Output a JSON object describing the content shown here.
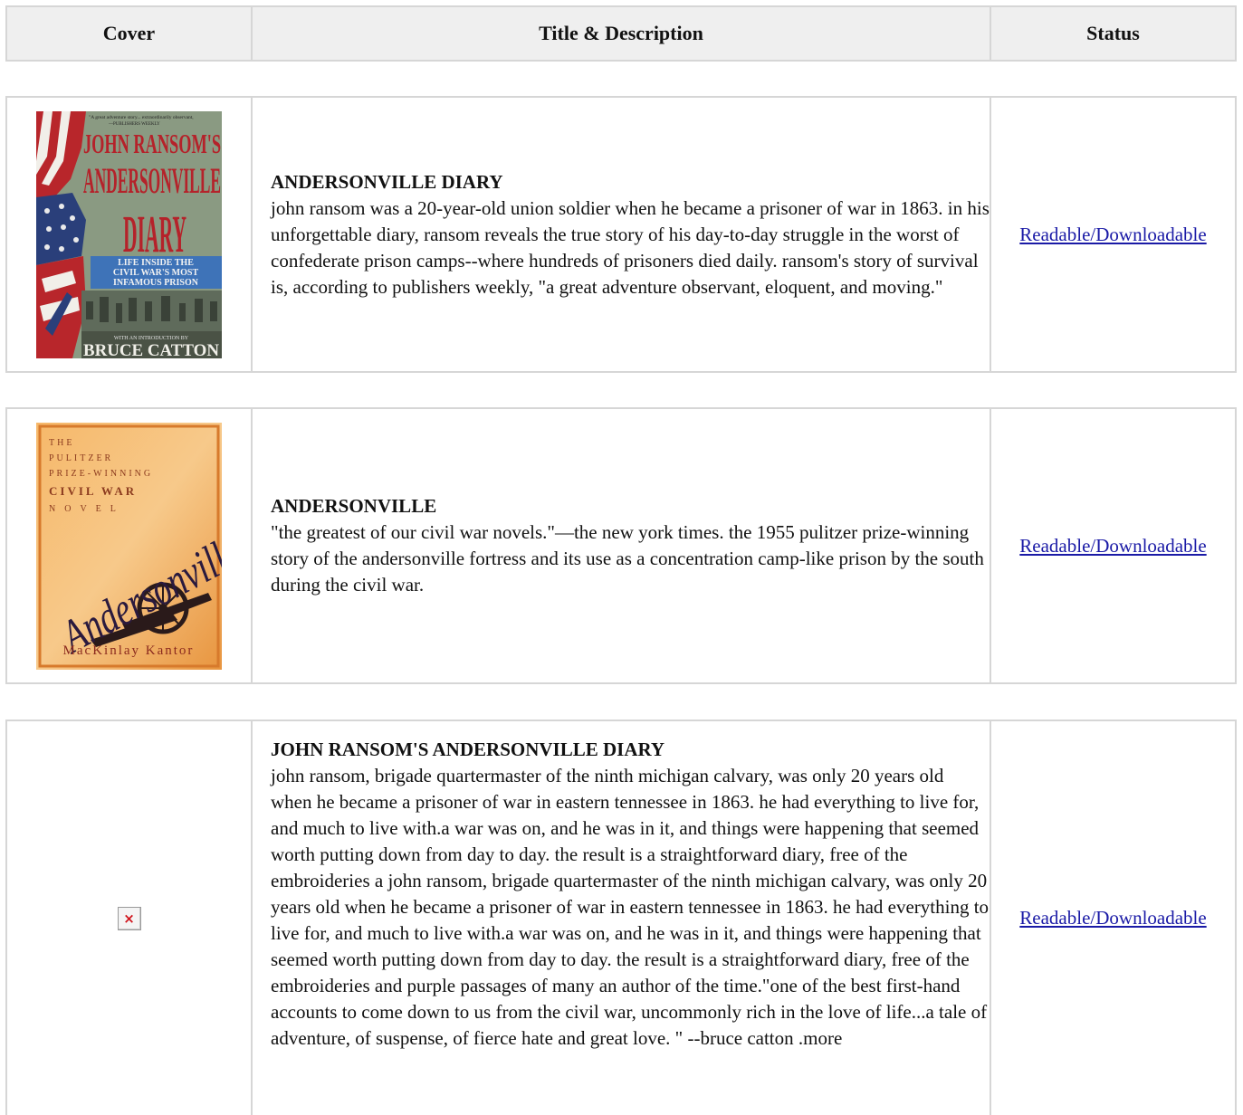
{
  "header": {
    "cover": "Cover",
    "title_desc": "Title & Description",
    "status": "Status"
  },
  "books": [
    {
      "title": "ANDERSONVILLE DIARY",
      "description": "john ransom was a 20-year-old union soldier when he became a prisoner of war in 1863. in his unforgettable diary, ransom reveals the true story of his day-to-day struggle in the worst of confederate prison camps--where hundreds of prisoners died daily. ransom's story of survival is, according to publishers weekly, \"a great adventure observant, eloquent, and moving.\"",
      "status": "Readable/Downloadable",
      "cover_text": {
        "blurb": "\"A great adventure story... extraordinarily observant, eloquent and moving.\" —PUBLISHERS WEEKLY",
        "line1": "JOHN RANSOM'S",
        "line2": "ANDERSONVILLE",
        "line3": "DIARY",
        "sub1": "LIFE INSIDE THE",
        "sub2": "CIVIL WAR'S MOST",
        "sub3": "INFAMOUS PRISON",
        "intro": "WITH AN INTRODUCTION BY",
        "author": "BRUCE CATTON"
      }
    },
    {
      "title": "ANDERSONVILLE",
      "description": "\"the greatest of our civil war novels.\"—the new york times. the 1955 pulitzer prize-winning story of the andersonville fortress and its use as a concentration camp-like prison by the south during the civil war.",
      "status": "Readable/Downloadable",
      "cover_text": {
        "l1": "THE",
        "l2": "PULITZER",
        "l3": "PRIZE-WINNING",
        "l4": "CIVIL WAR",
        "l5": "NOVEL",
        "script": "Andersonville",
        "author": "MacKinlay Kantor"
      }
    },
    {
      "title": "JOHN RANSOM'S ANDERSONVILLE DIARY",
      "description": "john ransom, brigade quartermaster of the ninth michigan calvary, was only 20 years old when he became a prisoner of war in eastern tennessee in 1863. he had everything to live for, and much to live with.a war was on, and he was in it, and things were happening that seemed worth putting down from day to day. the result is a straightforward diary, free of the embroideries a john ransom, brigade quartermaster of the ninth michigan calvary, was only 20 years old when he became a prisoner of war in eastern tennessee in 1863. he had everything to live for, and much to live with.a war was on, and he was in it, and things were happening that seemed worth putting down from day to day. the result is a straightforward diary, free of the embroideries and purple passages of many an author of the time.\"one of the best first-hand accounts to come down to us from the civil war, uncommonly rich in the love of life...a tale of adventure, of suspense, of fierce hate and great love. \" --bruce catton .more",
      "status": "Readable/Downloadable"
    }
  ]
}
